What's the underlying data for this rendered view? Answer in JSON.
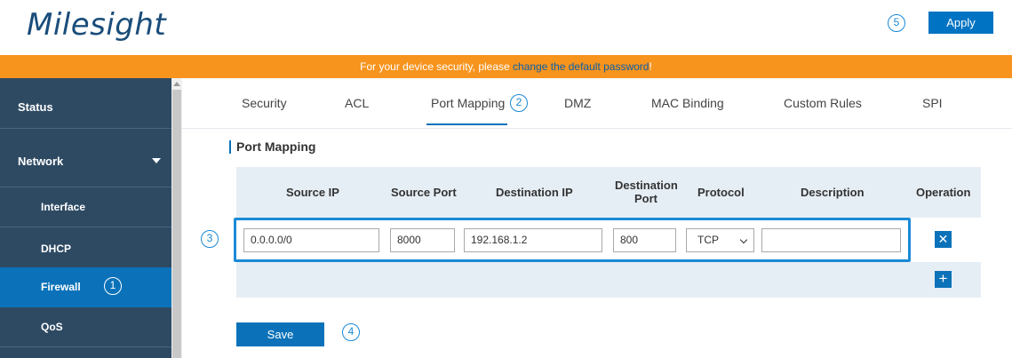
{
  "brand": {
    "logo_text": "Milesight"
  },
  "header": {
    "apply_label": "Apply",
    "apply_marker": "5"
  },
  "banner": {
    "text": "For your device security, please ",
    "link": "change the default password",
    "suffix": "!"
  },
  "sidebar": {
    "items": [
      {
        "label": "Status",
        "marker": ""
      },
      {
        "label": "Network",
        "marker": ""
      },
      {
        "label": "Interface",
        "marker": ""
      },
      {
        "label": "DHCP",
        "marker": ""
      },
      {
        "label": "Firewall",
        "marker": "1"
      },
      {
        "label": "QoS",
        "marker": ""
      }
    ]
  },
  "tabs": [
    {
      "label": "Security"
    },
    {
      "label": "ACL"
    },
    {
      "label": "Port Mapping",
      "marker": "2"
    },
    {
      "label": "DMZ"
    },
    {
      "label": "MAC Binding"
    },
    {
      "label": "Custom Rules"
    },
    {
      "label": "SPI"
    }
  ],
  "section": {
    "title": "Port Mapping"
  },
  "table": {
    "headers": {
      "source_ip": "Source IP",
      "source_port": "Source Port",
      "destination_ip": "Destination IP",
      "destination_port_1": "Destination",
      "destination_port_2": "Port",
      "protocol": "Protocol",
      "description": "Description",
      "operation": "Operation"
    },
    "row_marker": "3",
    "row": {
      "source_ip": "0.0.0.0/0",
      "source_port": "8000",
      "destination_ip": "192.168.1.2",
      "destination_port": "800",
      "protocol": "TCP",
      "description": ""
    },
    "delete_symbol": "✕",
    "add_symbol": "+"
  },
  "footer": {
    "save_label": "Save",
    "save_marker": "4"
  },
  "colors": {
    "accent": "#0b72b9",
    "banner": "#f7941d",
    "sidebar": "#2e4a63",
    "marker": "#1a8ad6"
  }
}
